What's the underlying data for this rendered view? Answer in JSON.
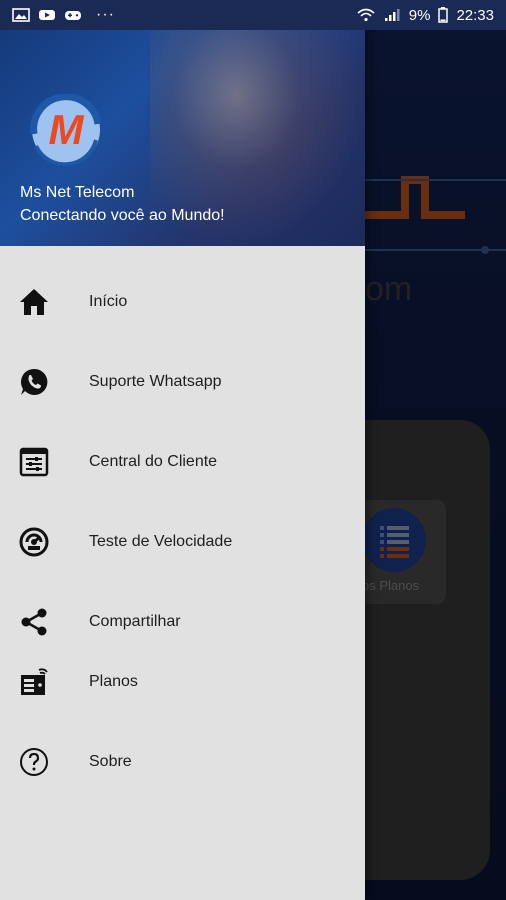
{
  "status_bar": {
    "battery_percent": "9%",
    "time": "22:33",
    "icons": [
      "image-icon",
      "youtube-icon",
      "gamepad-icon",
      "more-dots-icon",
      "wifi-icon",
      "signal-icon",
      "battery-icon"
    ]
  },
  "drawer": {
    "title": "Ms Net Telecom",
    "subtitle": "Conectando você ao Mundo!",
    "logo_letter": "M",
    "items": [
      {
        "label": "Início",
        "icon": "home-icon"
      },
      {
        "label": "Suporte Whatsapp",
        "icon": "whatsapp-icon"
      },
      {
        "label": "Central do Cliente",
        "icon": "settings-panel-icon"
      },
      {
        "label": "Teste de Velocidade",
        "icon": "speedtest-icon"
      },
      {
        "label": "Compartilhar",
        "icon": "share-icon"
      },
      {
        "label": "Planos",
        "icon": "plans-icon"
      },
      {
        "label": "Sobre",
        "icon": "help-icon"
      }
    ]
  },
  "background": {
    "plan_tile_label": "ssos Planos",
    "partial_text": "om"
  },
  "colors": {
    "drawer_bg": "#e1e1e1",
    "header_blue": "#1d4f9e",
    "logo_orange": "#e94a24",
    "logo_blue": "#1f57a9"
  }
}
